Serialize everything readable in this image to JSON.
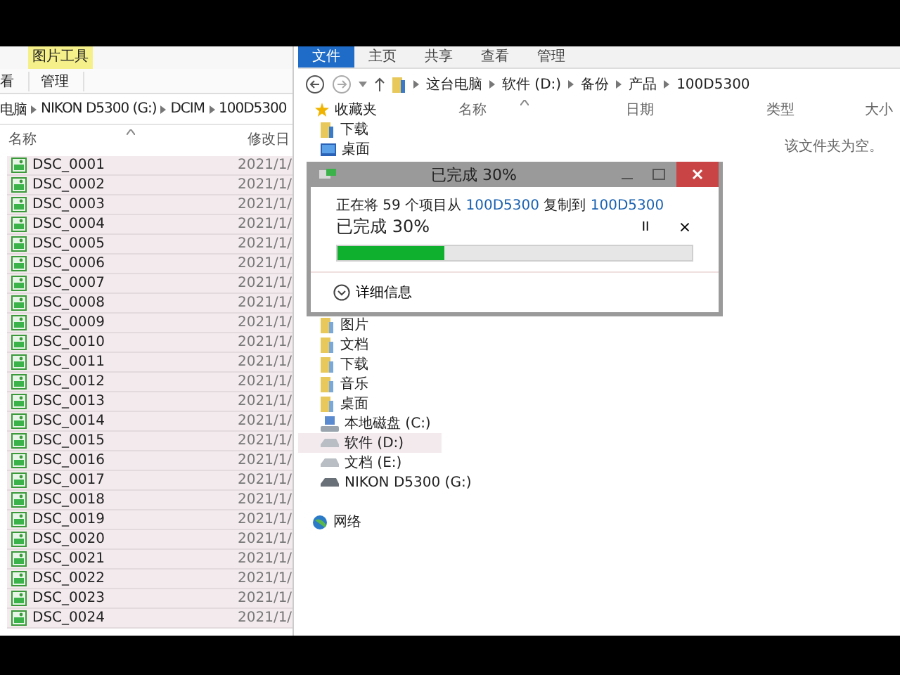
{
  "left_window": {
    "context_tab": "图片工具",
    "ribbon_tabs": [
      {
        "label": "看",
        "selected": false
      },
      {
        "label": "管理",
        "selected": false
      }
    ],
    "address": [
      "电脑",
      "NIKON D5300 (G:)",
      "DCIM",
      "100D5300"
    ],
    "columns": [
      "名称",
      "修改日"
    ],
    "rows": [
      {
        "name": "DSC_0001",
        "date": "2021/1/",
        "selected": true
      },
      {
        "name": "DSC_0002",
        "date": "2021/1/",
        "selected": true
      },
      {
        "name": "DSC_0003",
        "date": "2021/1/",
        "selected": true
      },
      {
        "name": "DSC_0004",
        "date": "2021/1/",
        "selected": true
      },
      {
        "name": "DSC_0005",
        "date": "2021/1/",
        "selected": true
      },
      {
        "name": "DSC_0006",
        "date": "2021/1/",
        "selected": true
      },
      {
        "name": "DSC_0007",
        "date": "2021/1/",
        "selected": true
      },
      {
        "name": "DSC_0008",
        "date": "2021/1/",
        "selected": true
      },
      {
        "name": "DSC_0009",
        "date": "2021/1/",
        "selected": true
      },
      {
        "name": "DSC_0010",
        "date": "2021/1/",
        "selected": true
      },
      {
        "name": "DSC_0011",
        "date": "2021/1/",
        "selected": true
      },
      {
        "name": "DSC_0012",
        "date": "2021/1/",
        "selected": true
      },
      {
        "name": "DSC_0013",
        "date": "2021/1/",
        "selected": true
      },
      {
        "name": "DSC_0014",
        "date": "2021/1/",
        "selected": true
      },
      {
        "name": "DSC_0015",
        "date": "2021/1/",
        "selected": true
      },
      {
        "name": "DSC_0016",
        "date": "2021/1/",
        "selected": true
      },
      {
        "name": "DSC_0017",
        "date": "2021/1/",
        "selected": true
      },
      {
        "name": "DSC_0018",
        "date": "2021/1/",
        "selected": true
      },
      {
        "name": "DSC_0019",
        "date": "2021/1/",
        "selected": true
      },
      {
        "name": "DSC_0020",
        "date": "2021/1/",
        "selected": true
      },
      {
        "name": "DSC_0021",
        "date": "2021/1/",
        "selected": true
      },
      {
        "name": "DSC_0022",
        "date": "2021/1/",
        "selected": true
      },
      {
        "name": "DSC_0023",
        "date": "2021/1/",
        "selected": true
      },
      {
        "name": "DSC_0024",
        "date": "2021/1/",
        "selected": true
      }
    ]
  },
  "right_window": {
    "ribbon_tabs": [
      {
        "label": "文件",
        "selected": true
      },
      {
        "label": "主页",
        "selected": false
      },
      {
        "label": "共享",
        "selected": false
      },
      {
        "label": "查看",
        "selected": false
      },
      {
        "label": "管理",
        "selected": false
      }
    ],
    "address": [
      "这台电脑",
      "软件 (D:)",
      "备份",
      "产品",
      "100D5300"
    ],
    "nav_top": [
      {
        "label": "收藏夹",
        "kind": "star",
        "selected": false
      },
      {
        "label": "下载",
        "kind": "folder",
        "selected": false
      },
      {
        "label": "桌面",
        "kind": "desktop",
        "selected": false
      }
    ],
    "nav_bottom": [
      {
        "label": "图片",
        "kind": "folder",
        "selected": false
      },
      {
        "label": "文档",
        "kind": "folder",
        "selected": false
      },
      {
        "label": "下载",
        "kind": "folder",
        "selected": false
      },
      {
        "label": "音乐",
        "kind": "folder",
        "selected": false
      },
      {
        "label": "桌面",
        "kind": "folder",
        "selected": false
      },
      {
        "label": "本地磁盘 (C:)",
        "kind": "system-drive",
        "selected": false
      },
      {
        "label": "软件 (D:)",
        "kind": "drive",
        "selected": true
      },
      {
        "label": "文档 (E:)",
        "kind": "drive",
        "selected": false
      },
      {
        "label": "NIKON D5300 (G:)",
        "kind": "usb-drive",
        "selected": false
      }
    ],
    "network": {
      "label": "网络"
    },
    "columns": [
      "名称",
      "日期",
      "类型",
      "大小"
    ],
    "empty_message": "该文件夹为空。"
  },
  "copy_dialog": {
    "title": "已完成 30%",
    "message": {
      "prefix": "正在将 59 个项目从 ",
      "source": "100D5300",
      "middle": " 复制到 ",
      "target": "100D5300"
    },
    "status": "已完成 30%",
    "level": 0.3,
    "pause": "II",
    "cancel": "×",
    "details": "详细信息"
  }
}
